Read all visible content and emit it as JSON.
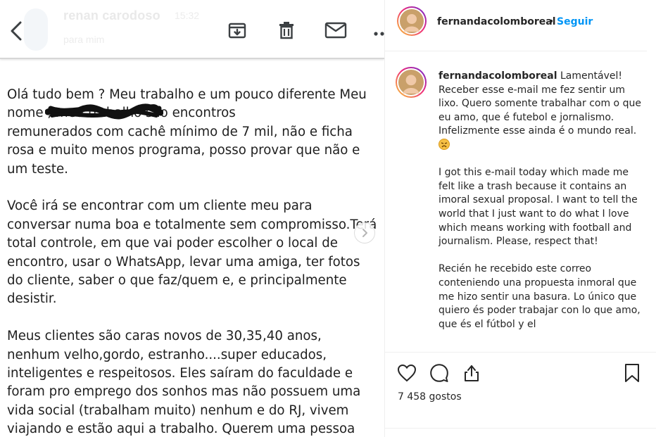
{
  "email": {
    "sender_name": "renan carodoso",
    "sender_time": "15:32",
    "sender_sub": "para mim",
    "body": [
      "Olá tudo bem ? Meu trabalho e um pouco diferente Meu\nnome                             , meu trabalho são encontros\nremunerados com cachê mínimo de 7 mil, não e ficha\nrosa e muito menos programa, posso provar que não e\num teste.",
      "Você irá se encontrar com um cliente meu para\nconversar numa boa e totalmente sem compromisso.Terá\ntotal controle, em que vai poder escolher o local de\nencontro, usar o WhatsApp, levar uma amiga, ter fotos\ndo cliente, saber o que faz/quem e, e principalmente\ndesistir.",
      "Meus clientes são caras novos de 30,35,40 anos,\nnenhum velho,gordo, estranho....super educados,\ninteligentes e respeitosos. Eles saíram do faculdade e\nforam pro emprego dos sonhos mas não possuem uma\nvida social (trabalham muito) nenhum e do RJ, vivem\nviajando e estão aqui a trabalho. Querem   uma pessoa"
    ]
  },
  "instagram": {
    "username": "fernandacolomboreal",
    "dot": "•",
    "follow_label": "Seguir",
    "caption_username": "fernandacolomboreal",
    "caption_pt": "Lamentável! Receber esse e-mail me fez sentir um lixo. Quero somente trabalhar com o que eu amo, que é futebol e jornalismo. Infelizmente esse ainda é o mundo real.",
    "caption_en": "I got this e-mail today which made me felt like a trash because it contains an imoral sexual proposal. I want to tell the world that I just want to do what I love which means working with football and journalism. Please, respect that!",
    "caption_es": "Recién he recebido este correo conteniendo una propuesta inmoral que me hizo sentir una basura. Lo único que quiero és poder trabajar con lo que amo, que és el fútbol y el",
    "likes": "7 458 gostos",
    "emoji": "disappointed-face",
    "accent": "#0095f6"
  }
}
